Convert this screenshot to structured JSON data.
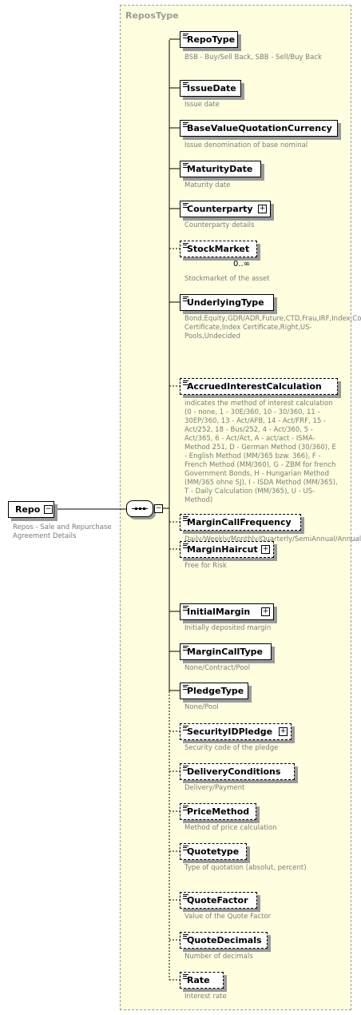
{
  "type_name": "ReposType",
  "root": {
    "name": "Repo",
    "description": "Repos - Sale and Repurchase Agreement Details"
  },
  "elements": [
    {
      "name": "RepoType",
      "optional": false,
      "expandable": false,
      "description": "BSB - Buy/Sell Back, SBB - Sell/Buy Back"
    },
    {
      "name": "IssueDate",
      "optional": false,
      "expandable": false,
      "description": "Issue date"
    },
    {
      "name": "BaseValueQuotationCurrency",
      "optional": false,
      "expandable": false,
      "description": "Issue denomination of base nominal"
    },
    {
      "name": "MaturityDate",
      "optional": false,
      "expandable": false,
      "description": "Maturity date"
    },
    {
      "name": "Counterparty",
      "optional": false,
      "expandable": true,
      "description": "Counterparty details"
    },
    {
      "name": "StockMarket",
      "optional": true,
      "expandable": false,
      "cardinality": "0..∞",
      "description": "Stockmarket of the asset"
    },
    {
      "name": "UnderlyingType",
      "optional": false,
      "expandable": false,
      "description": "Bond,Equity,GDR/ADR,Future,CTD,Frau,IRF,Index,Commodity,Fund Certificate,Index Certificate,Right,US-Pools,Undecided"
    },
    {
      "name": "AccruedInterestCalculation",
      "optional": true,
      "expandable": false,
      "description": "indicates the method of interest calculation (0 - none, 1 - 30E/360, 10 - 30/360, 11 - 30EP/360, 13 - Act/AFB, 14 - Act/FRF, 15 - Act/252, 18 - Bus/252, 4 - Act/360, 5 - Act/365, 6 - Act/Act, A - act/act - ISMA-Method 251, D - German Method (30/360), E - English Method (MM/365 bzw. 366), F - French Method (MM/360), G - ZBM for french Government Bonds, H - Hungarian Method (MM/365 ohne SJ), I - ISDA Method (MM/365), T - Daily Calculation (MM/365), U - US-Method)"
    },
    {
      "name": "MarginCallFrequency",
      "optional": true,
      "expandable": false,
      "description": "Daily/Weekly/Monthly/Quarterly/SemiAnnual/Annual/BiAnnual"
    },
    {
      "name": "MarginHaircut",
      "optional": true,
      "expandable": true,
      "description": "Free for Risk"
    },
    {
      "name": "InitialMargin",
      "optional": false,
      "expandable": true,
      "description": "Initially deposited margin"
    },
    {
      "name": "MarginCallType",
      "optional": false,
      "expandable": false,
      "description": "None/Contract/Pool"
    },
    {
      "name": "PledgeType",
      "optional": false,
      "expandable": false,
      "description": "None/Pool"
    },
    {
      "name": "SecurityIDPledge",
      "optional": true,
      "expandable": true,
      "description": "Security code of the pledge"
    },
    {
      "name": "DeliveryConditions",
      "optional": true,
      "expandable": false,
      "description": "Delivery/Payment"
    },
    {
      "name": "PriceMethod",
      "optional": true,
      "expandable": false,
      "description": "Method of price calculation"
    },
    {
      "name": "Quotetype",
      "optional": true,
      "expandable": false,
      "description": "Type of quotation (absolut, percent)"
    },
    {
      "name": "QuoteFactor",
      "optional": true,
      "expandable": false,
      "description": "Value of the Quote Factor"
    },
    {
      "name": "QuoteDecimals",
      "optional": true,
      "expandable": false,
      "description": "Number of decimals"
    },
    {
      "name": "Rate",
      "optional": true,
      "expandable": false,
      "description": "Interest rate"
    }
  ]
}
